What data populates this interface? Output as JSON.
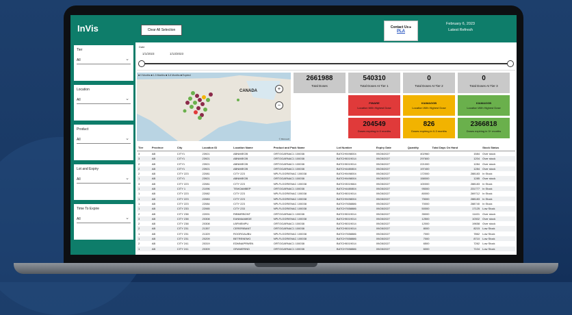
{
  "app": {
    "title": "InVis",
    "clear_button": "Clear All Selection",
    "contact_label": "Contact Us ▸",
    "contact_name": "PLA",
    "date": "February 6, 2023",
    "refresh": "Latest Refresh"
  },
  "filters": [
    {
      "title": "Tier",
      "value": "All"
    },
    {
      "title": "Location",
      "value": "All"
    },
    {
      "title": "Product",
      "value": "All"
    },
    {
      "title": "Lot and Expiry",
      "value": "All"
    },
    {
      "title": "Time To Expire",
      "value": "All"
    }
  ],
  "date_slicer": {
    "title": "Date",
    "start": "1/1/2023",
    "end": "1/13/2023"
  },
  "map": {
    "legend": "■ 0 Months ■ 1-3 Months ■ 3-6 Months ■ Expired",
    "label": "CANADA",
    "footer": "© Microsoft"
  },
  "kpis": [
    {
      "value": "2661988",
      "label": "Total Doses"
    },
    {
      "value": "540310",
      "label": "Total Doses At Tier 1"
    },
    {
      "value": "0",
      "label": "Total Doses At Tier 2"
    },
    {
      "value": "0",
      "label": "Total Doses At Tier 3"
    }
  ],
  "status_cards": [
    {
      "top": "FIWARE",
      "big": "",
      "sub": "Location With Highest Dose",
      "color": "#e03a3a"
    },
    {
      "top": "KIAMAGGB",
      "big": "",
      "sub": "Location With Highest Dose",
      "color": "#f2b300"
    },
    {
      "top": "KIAMAGGB",
      "big": "",
      "sub": "Location With Highest Dose",
      "color": "#6ab04c"
    },
    {
      "top": "",
      "big": "204549",
      "sub": "Doses expiring in 0 months",
      "color": "#e03a3a"
    },
    {
      "top": "",
      "big": "826",
      "sub": "Doses expiring in 0-3 months",
      "color": "#f2b300"
    },
    {
      "top": "",
      "big": "2366818",
      "sub": "Doses expiring in 3+ months",
      "color": "#6ab04c"
    }
  ],
  "table": {
    "headers": [
      "Tier",
      "Province",
      "City",
      "Location ID",
      "Location Name",
      "Product and Pack Name",
      "Lot Number",
      "Expiry Date",
      "Quantity",
      "Total Days On Hand",
      "Stock Status"
    ],
    "rows": [
      [
        "3",
        "AB",
        "CITY1",
        "23921",
        "ABNMIEOB",
        "ORTOGARNAC1 100038",
        "BATCH9498004",
        "09/28/2027",
        "402960",
        "1584",
        "Over stock"
      ],
      [
        "3",
        "AB",
        "CITY1",
        "23921",
        "ABNMIEOB",
        "ORTOGARNAC1 100038",
        "BATCH5019014",
        "09/28/2027",
        "297600",
        "1204",
        "Over stock"
      ],
      [
        "2",
        "AB",
        "CITY1",
        "23921",
        "ABNMIEOB",
        "ORTOGARNAC1 100038",
        "BATCH5019014",
        "09/28/2027",
        "221000",
        "1284",
        "Over stock"
      ],
      [
        "2",
        "AB",
        "CITY1",
        "23921",
        "ABNMIEOB",
        "ORTOGARNAC1 100038",
        "BATCH4480804",
        "09/28/2027",
        "197400",
        "1284",
        "Over stock"
      ],
      [
        "2",
        "AB",
        "CITY 223",
        "22081",
        "CITY 223",
        "NPLFLOGRIENAC 100038",
        "BATCH9498004",
        "09/28/2027",
        "172000",
        "288183",
        "In Stock"
      ],
      [
        "1",
        "AB",
        "CITY1",
        "23921",
        "ABNMIEOB",
        "ORTOGARNAC1 100038",
        "BATCH9498004",
        "09/28/2027",
        "158000",
        "1285",
        "Over stock"
      ],
      [
        "3",
        "AB",
        "CITY 223",
        "22081",
        "CITY 223",
        "NPLFLOGRIENAC 100038",
        "BATCH3019664",
        "09/28/2027",
        "100000",
        "288183",
        "In Stock"
      ],
      [
        "1",
        "AB",
        "CITY 1",
        "21096",
        "TEMOAMBEP",
        "ORTOGARNAC1 100038",
        "BATCH4480804",
        "09/28/2027",
        "95000",
        "231777",
        "In Stock"
      ],
      [
        "1",
        "AB",
        "CITY 223",
        "22082",
        "CITY 223",
        "NPLFLOGRIENAC 100038",
        "BATCH5019014",
        "09/28/2027",
        "80000",
        "269712",
        "In Stock"
      ],
      [
        "1",
        "AB",
        "CITY 223",
        "22083",
        "CITY 223",
        "NPLFLOGRIENAC 100038",
        "BATCH9498004",
        "09/28/2027",
        "75000",
        "288183",
        "In Stock"
      ],
      [
        "1",
        "AB",
        "CITY 223",
        "22084",
        "CITY 223",
        "NPLFLOGRIENAC 100038",
        "BATCH7658886",
        "09/28/2027",
        "70000",
        "288740",
        "In Stock"
      ],
      [
        "1",
        "AB",
        "CITY 233",
        "22065",
        "CITY 233",
        "NPLFLOGRIENAC 100038",
        "BATCH7658886",
        "09/28/2027",
        "50000",
        "17125",
        "Low Stock"
      ],
      [
        "2",
        "AB",
        "CITY 238",
        "22091",
        "RIBMIRBONT",
        "ORTOGARNAC1 100038",
        "BATCH5019014",
        "09/28/2027",
        "35000",
        "11401",
        "Over stock"
      ],
      [
        "3",
        "AB",
        "CITY 238",
        "20308",
        "EANMAAMIDE",
        "NPLFLOGRIENAC 100038",
        "BATCH5019014",
        "09/28/2027",
        "12500",
        "10302",
        "Over stock"
      ],
      [
        "2",
        "AB",
        "CITY 238",
        "20308",
        "LBFMEMPU",
        "ORTOGARNAC1 100038",
        "BATCH5019014",
        "09/28/2027",
        "12000",
        "19658",
        "Over stock"
      ],
      [
        "2",
        "AB",
        "CITY 231",
        "21357",
        "CERERIBANT",
        "ORTOGARNAC1 100038",
        "BATCH5019014",
        "09/28/2027",
        "8000",
        "8215",
        "Low Stock"
      ],
      [
        "1",
        "AB",
        "CITY 231",
        "21329",
        "ROGRGAUBU",
        "NPLFLOGRIENAC 100038",
        "BATCH7658886",
        "09/28/2027",
        "7000",
        "7862",
        "Low Stock"
      ],
      [
        "1",
        "AB",
        "CITY 231",
        "20209",
        "BETRENEMG",
        "NPLFLOGRIENAC 100038",
        "BATCH7658886",
        "09/28/2027",
        "7000",
        "8710",
        "Low Stock"
      ],
      [
        "2",
        "AB",
        "CITY 241",
        "20319",
        "EDMNAPRWEN",
        "ORTOGARNAC1 100038",
        "BATCH5019014",
        "09/28/2027",
        "6500",
        "7262",
        "Low Stock"
      ],
      [
        "1",
        "AB",
        "CITY 241",
        "20309",
        "GRANERIND",
        "ORTOGARNAC1 100038",
        "BATCH7658886",
        "09/28/2027",
        "6000",
        "7104",
        "Low Stock"
      ]
    ]
  },
  "colors": {
    "brand": "#0e7d6a",
    "red": "#e03a3a",
    "amber": "#f2b300",
    "green": "#6ab04c"
  }
}
